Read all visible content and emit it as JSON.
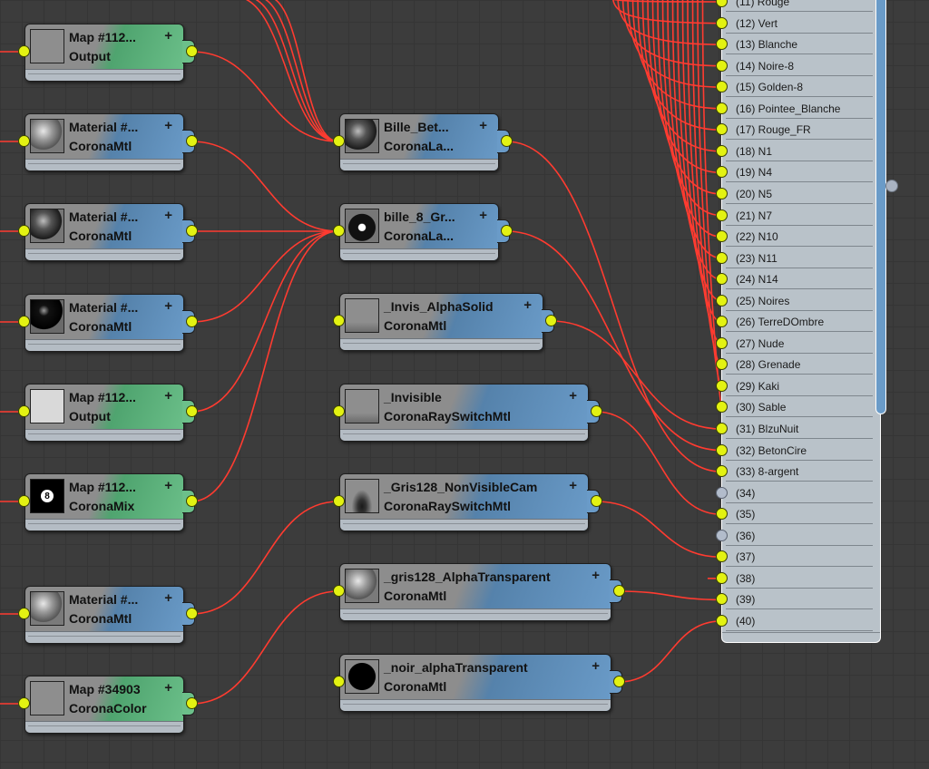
{
  "nodes": [
    {
      "id": "map112_output_a",
      "title": "Map #112...",
      "type": "Output",
      "color": "green",
      "thumb": "plain"
    },
    {
      "id": "material_a",
      "title": "Material #...",
      "type": "CoronaMtl",
      "color": "blue",
      "thumb": "sphere-grey"
    },
    {
      "id": "material_b",
      "title": "Material #...",
      "type": "CoronaMtl",
      "color": "blue",
      "thumb": "sphere-dark"
    },
    {
      "id": "material_c",
      "title": "Material #...",
      "type": "CoronaMtl",
      "color": "blue",
      "thumb": "sphere-black"
    },
    {
      "id": "map112_output_b",
      "title": "Map #112...",
      "type": "Output",
      "color": "green",
      "thumb": "white"
    },
    {
      "id": "map112_mix",
      "title": "Map #112...",
      "type": "CoronaMix",
      "color": "green",
      "thumb": "eight",
      "badge": "8"
    },
    {
      "id": "material_d",
      "title": "Material #...",
      "type": "CoronaMtl",
      "color": "blue",
      "thumb": "sphere-grey"
    },
    {
      "id": "map34903",
      "title": "Map #34903",
      "type": "CoronaColor",
      "color": "green",
      "thumb": "plain"
    },
    {
      "id": "bille_bet",
      "title": "Bille_Bet...",
      "type": "CoronaLa...",
      "color": "blue",
      "thumb": "sphere-dark"
    },
    {
      "id": "bille_8",
      "title": "bille_8_Gr...",
      "type": "CoronaLa...",
      "color": "blue",
      "thumb": "ball8"
    },
    {
      "id": "invis_alpha",
      "title": "_Invis_AlphaSolid",
      "type": "CoronaMtl",
      "color": "blue",
      "thumb": "shadow"
    },
    {
      "id": "invisible",
      "title": "_Invisible",
      "type": "CoronaRaySwitchMtl",
      "color": "blue",
      "thumb": "shadow"
    },
    {
      "id": "gris128_nvc",
      "title": "_Gris128_NonVisibleCam",
      "type": "CoronaRaySwitchMtl",
      "color": "blue",
      "thumb": "shadow2"
    },
    {
      "id": "gris128_at",
      "title": "_gris128_AlphaTransparent",
      "type": "CoronaMtl",
      "color": "blue",
      "thumb": "sphere-grey"
    },
    {
      "id": "noir_at",
      "title": "_noir_alphaTransparent",
      "type": "CoronaMtl",
      "color": "blue",
      "thumb": "sphere-black2"
    }
  ],
  "plus_icon": "+",
  "output_slots": [
    {
      "label": "(11) Rouge",
      "connected": true
    },
    {
      "label": "(12) Vert",
      "connected": true
    },
    {
      "label": "(13) Blanche",
      "connected": true
    },
    {
      "label": "(14) Noire-8",
      "connected": true
    },
    {
      "label": "(15) Golden-8",
      "connected": true
    },
    {
      "label": "(16) Pointee_Blanche",
      "connected": true
    },
    {
      "label": "(17) Rouge_FR",
      "connected": true
    },
    {
      "label": "(18) N1",
      "connected": true
    },
    {
      "label": "(19) N4",
      "connected": true
    },
    {
      "label": "(20) N5",
      "connected": true
    },
    {
      "label": "(21) N7",
      "connected": true
    },
    {
      "label": "(22) N10",
      "connected": true
    },
    {
      "label": "(23) N11",
      "connected": true
    },
    {
      "label": "(24) N14",
      "connected": true
    },
    {
      "label": "(25) Noires",
      "connected": true
    },
    {
      "label": "(26) TerreDOmbre",
      "connected": true
    },
    {
      "label": "(27) Nude",
      "connected": true
    },
    {
      "label": "(28) Grenade",
      "connected": true
    },
    {
      "label": "(29) Kaki",
      "connected": true
    },
    {
      "label": "(30) Sable",
      "connected": true
    },
    {
      "label": "(31) BlzuNuit",
      "connected": true
    },
    {
      "label": "(32) BetonCire",
      "connected": true
    },
    {
      "label": "(33) 8-argent",
      "connected": true
    },
    {
      "label": "(34)",
      "connected": false
    },
    {
      "label": "(35)",
      "connected": true
    },
    {
      "label": "(36)",
      "connected": false
    },
    {
      "label": "(37)",
      "connected": true
    },
    {
      "label": "(38)",
      "connected": true
    },
    {
      "label": "(39)",
      "connected": true
    },
    {
      "label": "(40)",
      "connected": true
    }
  ],
  "colors": {
    "wire": "#ff3b30",
    "socket": "#e3f212",
    "blue_node": "#6a9bc8",
    "green_node": "#6cc08a",
    "background": "#3c3c3c"
  }
}
